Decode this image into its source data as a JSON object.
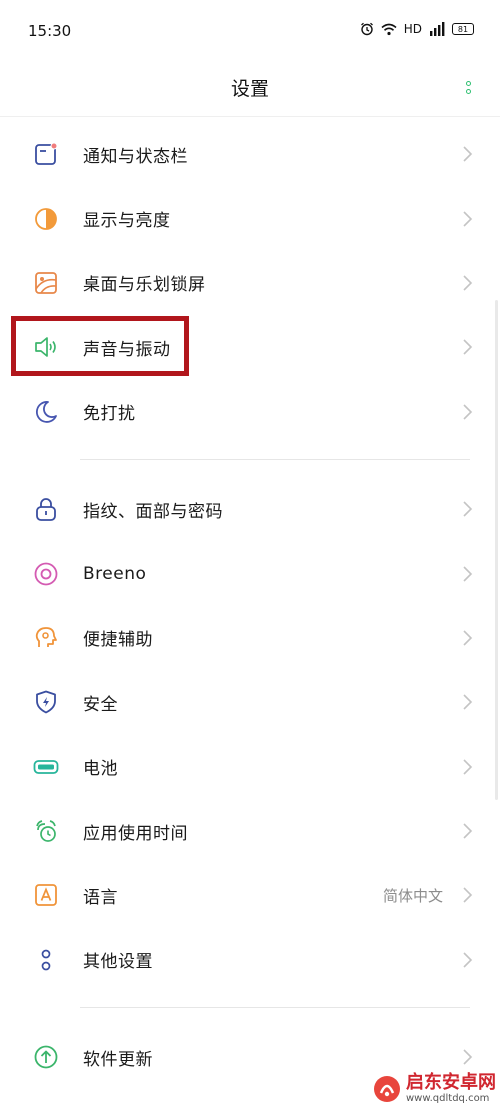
{
  "status_bar": {
    "time": "15:30",
    "network": "HD",
    "battery": "81"
  },
  "header": {
    "title": "设置"
  },
  "settings": {
    "group1": [
      {
        "label": "通知与状态栏",
        "icon": "notification-icon"
      },
      {
        "label": "显示与亮度",
        "icon": "brightness-icon"
      },
      {
        "label": "桌面与乐划锁屏",
        "icon": "wallpaper-icon"
      },
      {
        "label": "声音与振动",
        "icon": "speaker-icon"
      },
      {
        "label": "免打扰",
        "icon": "moon-icon"
      }
    ],
    "group2": [
      {
        "label": "指纹、面部与密码",
        "icon": "lock-icon"
      },
      {
        "label": "Breeno",
        "icon": "breeno-icon"
      },
      {
        "label": "便捷辅助",
        "icon": "assist-icon"
      },
      {
        "label": "安全",
        "icon": "shield-icon"
      },
      {
        "label": "电池",
        "icon": "battery-icon"
      },
      {
        "label": "应用使用时间",
        "icon": "alarm-icon"
      },
      {
        "label": "语言",
        "icon": "language-icon",
        "value": "简体中文"
      },
      {
        "label": "其他设置",
        "icon": "other-settings-icon"
      }
    ],
    "group3": [
      {
        "label": "软件更新",
        "icon": "update-icon"
      }
    ]
  },
  "watermark": {
    "name": "启东安卓网",
    "url": "www.qdltdq.com"
  },
  "colors": {
    "accent_green": "#2fbf71",
    "highlight_red": "#b1161c"
  }
}
